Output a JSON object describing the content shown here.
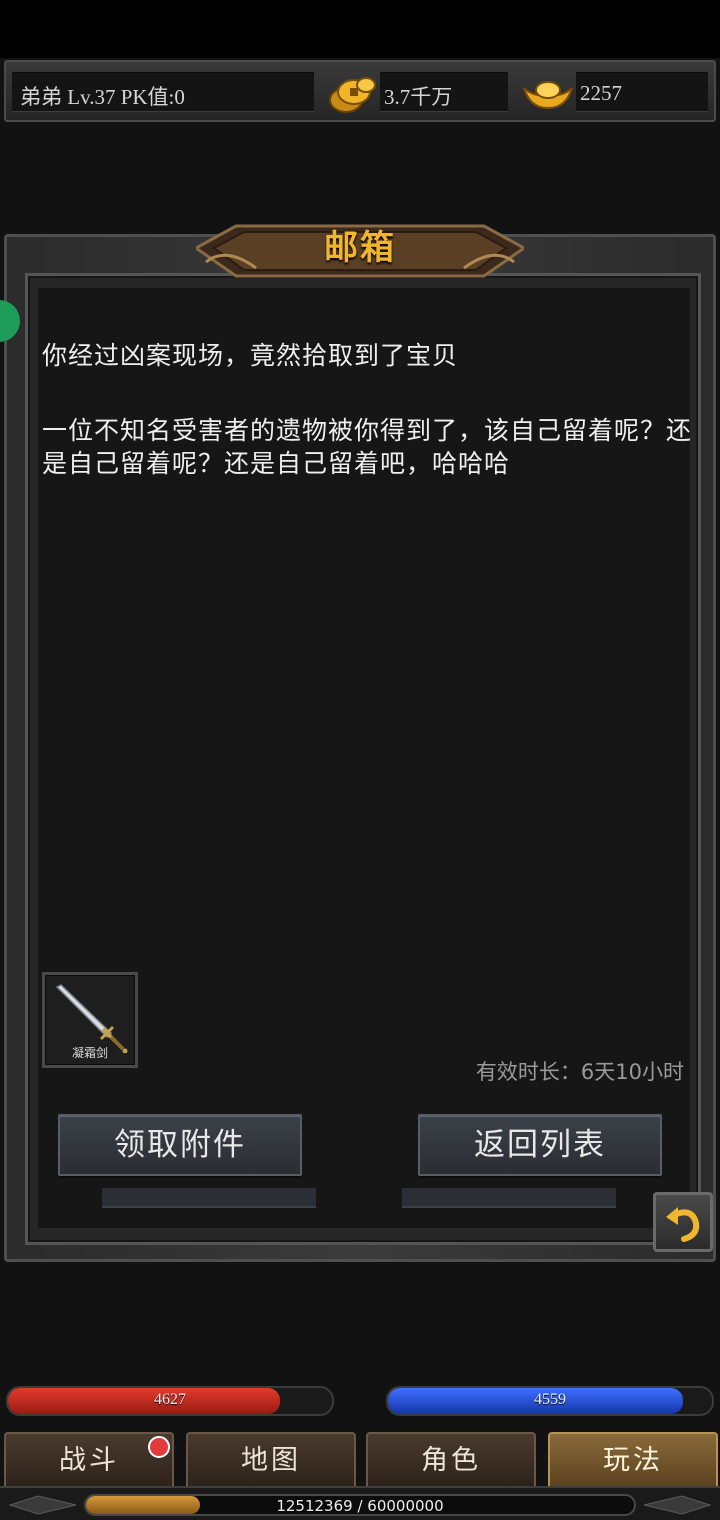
{
  "header": {
    "player_info": "弟弟  Lv.37 PK值:0",
    "gold_amount": "3.7千万",
    "ingot_amount": "2257"
  },
  "mailbox": {
    "title": "邮箱",
    "subject": "你经过凶案现场，竟然拾取到了宝贝",
    "body": "一位不知名受害者的遗物被你得到了，该自己留着呢？还是自己留着呢？还是自己留着吧，哈哈哈",
    "attachment": {
      "name": "凝霜剑",
      "icon": "sword-icon"
    },
    "validity": "有效时长：6天10小时",
    "claim_button": "领取附件",
    "back_button": "返回列表"
  },
  "stats": {
    "hp": {
      "value": "4627",
      "fill": 0.84
    },
    "mp": {
      "value": "4559",
      "fill": 0.91
    }
  },
  "tabs": [
    {
      "label": "战斗",
      "badge": true
    },
    {
      "label": "地图"
    },
    {
      "label": "角色"
    },
    {
      "label": "玩法",
      "active": true
    }
  ],
  "exp": {
    "text": "12512369 / 60000000",
    "fill": 0.2085
  },
  "colors": {
    "accent_gold": "#f0b62e",
    "hp": "#e23a2d",
    "mp": "#3d6fff"
  }
}
